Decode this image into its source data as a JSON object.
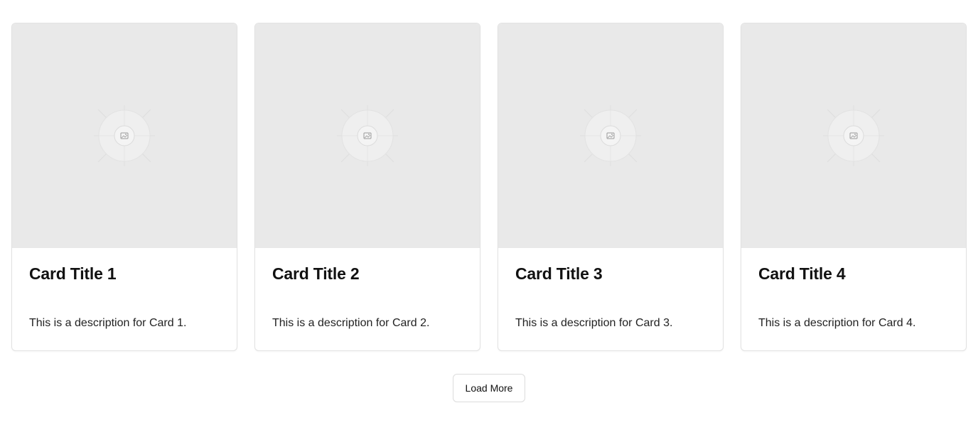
{
  "cards": [
    {
      "title": "Card Title 1",
      "description": "This is a description for Card 1.",
      "image_icon": "image-placeholder-icon"
    },
    {
      "title": "Card Title 2",
      "description": "This is a description for Card 2.",
      "image_icon": "image-placeholder-icon"
    },
    {
      "title": "Card Title 3",
      "description": "This is a description for Card 3.",
      "image_icon": "image-placeholder-icon"
    },
    {
      "title": "Card Title 4",
      "description": "This is a description for Card 4.",
      "image_icon": "image-placeholder-icon"
    }
  ],
  "load_more": {
    "label": "Load More"
  },
  "colors": {
    "placeholder_bg": "#e9e9e9",
    "card_border": "#e2e2e2",
    "title_text": "#111111",
    "body_text": "#222222"
  }
}
